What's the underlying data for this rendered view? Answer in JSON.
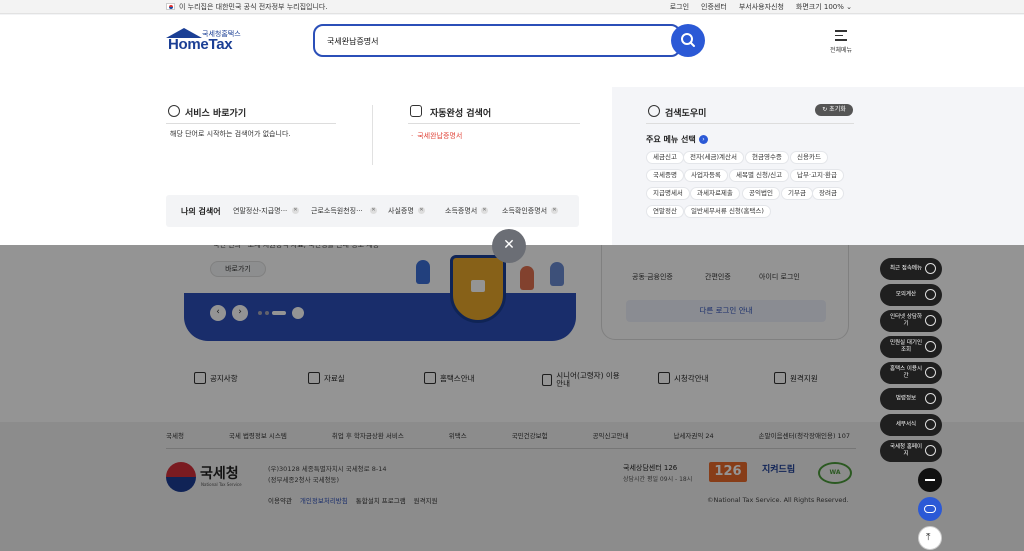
{
  "gov_bar": {
    "notice": "이 누리집은 대한민국 공식 전자정부 누리집입니다.",
    "links": [
      "로그인",
      "인증센터",
      "부서사용자신청",
      "화면크기 100% ⌄"
    ]
  },
  "header": {
    "logo_sub": "국세청홈택스",
    "logo_main": "HomeTax",
    "search_value": "국세완납증명서",
    "menu_label": "전체메뉴"
  },
  "dropdown": {
    "service_title": "서비스 바로가기",
    "service_empty": "해당 단어로 시작하는 검색어가 없습니다.",
    "auto_title": "자동완성 검색어",
    "auto_items": [
      "국세완납증명서"
    ],
    "my_search_title": "나의 검색어",
    "my_search_items": [
      "연말정산-지급명···",
      "근로소득원천징···",
      "사실증명",
      "소득증명서",
      "소득확인증명서"
    ],
    "helper_title": "검색도우미",
    "refresh_label": "↻ 초기화",
    "menu_select_label": "주요 메뉴 선택",
    "tags": [
      [
        "세금신고",
        "전자(세금)계산서",
        "현금영수증",
        "신용카드"
      ],
      [
        "국세증명",
        "사업자등록",
        "세목별 신청/신고",
        "납부·고지·환급"
      ],
      [
        "지급명세서",
        "과세자료제출",
        "공익법인",
        "기부금",
        "장려금"
      ],
      [
        "연말정산",
        "일반세무서류 신청(홈택스)"
      ]
    ]
  },
  "backdrop": {
    "banner_text": "국민 편의 · 조세 지원정책 자료, 국민생활 안내 정보 제공",
    "shortcut_label": "바로가기",
    "login_options": [
      "공동·금융인증",
      "간편인증",
      "아이디 로그인"
    ],
    "other_login": "다른 로그인 안내",
    "quick_links": [
      "공지사항",
      "자료실",
      "홈택스안내",
      "시니어(고령자) 이용 안내",
      "시청각안내",
      "원격지원"
    ]
  },
  "footer": {
    "links": [
      "국세청",
      "국세 법령정보 시스템",
      "취업 후 학자금상환 서비스",
      "위택스",
      "국민건강보험",
      "공익신고안내",
      "납세자권익 24",
      "손말이음센터(청각장애인용) 107"
    ],
    "org_name": "국세청",
    "org_en": "National Tax Service",
    "address1": "(우)30128 세종특별자치시 국세청로 8-14",
    "address2": "(정부세종2청사 국세청동)",
    "sub_links": [
      "이용약관",
      "개인정보처리방침",
      "통합설치 프로그램",
      "원격지원"
    ],
    "call_center": "국세상담센터 126",
    "call_hours": "상담시간 평일 09시 - 18시",
    "badge_126": "126",
    "badge_jt": "지켜드림",
    "badge_wa": "WA",
    "copyright": "©National Tax Service. All Rights Reserved."
  },
  "side_menu": [
    "최근 접속메뉴",
    "모의계산",
    "인터넷 상담하기",
    "민원실 대기인 조회",
    "홈택스 이용시간",
    "법령정보",
    "세무서식",
    "국세청 홈페이지"
  ],
  "colors": {
    "brand": "#1b3f95",
    "accent": "#2b59d6",
    "auto_highlight": "#e0453a"
  }
}
